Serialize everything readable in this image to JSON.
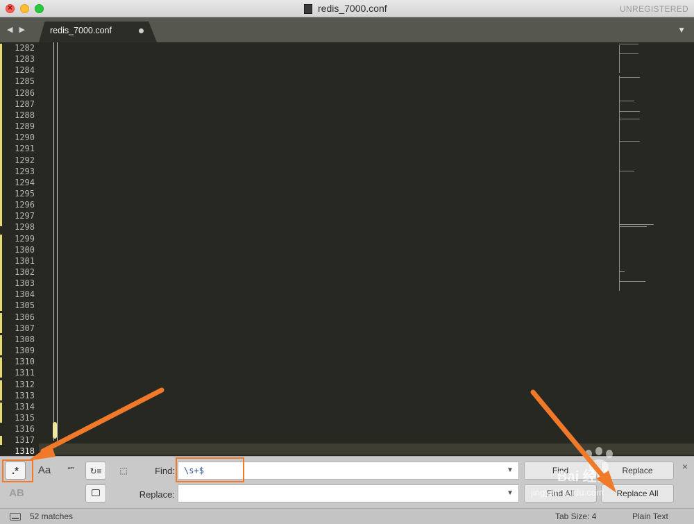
{
  "window": {
    "title": "redis_7000.conf",
    "registration": "UNREGISTERED"
  },
  "tabbar": {
    "nav_arrows": "◀ ▶",
    "active_tab": "redis_7000.conf",
    "menu_glyph": "▼"
  },
  "editor": {
    "line_numbers": [
      "1282",
      "1283",
      "1284",
      "1285",
      "1286",
      "1287",
      "1288",
      "1289",
      "1290",
      "1291",
      "1292",
      "1293",
      "1294",
      "1295",
      "1296",
      "1297",
      "1298",
      "1299",
      "1300",
      "1301",
      "1302",
      "1303",
      "1304",
      "1305",
      "1306",
      "1307",
      "1308",
      "1309",
      "1310",
      "1311",
      "1312",
      "1313",
      "1314",
      "1315",
      "1316",
      "1317",
      "1318"
    ],
    "current_line": "1318"
  },
  "find_panel": {
    "regex_label": ".*",
    "case_label": "Aa",
    "word_label": "“”",
    "wrap_label": "↻≡",
    "in_selection_label": "⬚",
    "case_preserve_label": "AB",
    "find_label": "Find:",
    "find_value": "\\s+$",
    "replace_label": "Replace:",
    "replace_value": "",
    "find_button": "Find",
    "find_all_button": "Find All",
    "replace_button": "Replace",
    "replace_all_button": "Replace All",
    "close_glyph": "×",
    "dropdown_glyph": "▼"
  },
  "status_bar": {
    "matches": "52 matches",
    "tab_size": "Tab Size: 4",
    "syntax": "Plain Text"
  },
  "watermark": {
    "brand": "Bai 经验",
    "url": "jingyan.baidu.com"
  },
  "colors": {
    "editor_bg": "#272822",
    "modified_marker": "#e6db74",
    "annotation_orange": "#f07a2a"
  }
}
